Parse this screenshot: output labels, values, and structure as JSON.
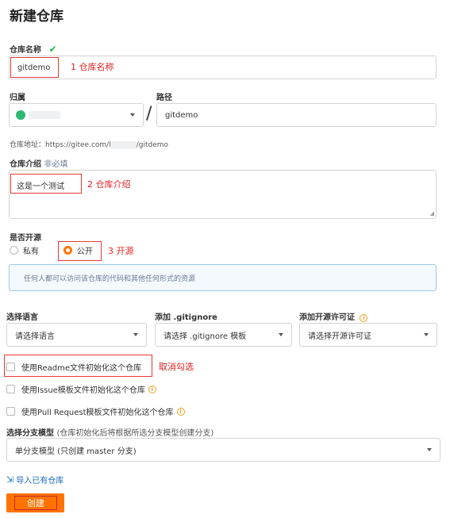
{
  "page": {
    "title": "新建仓库"
  },
  "repo_name": {
    "label": "仓库名称",
    "value": "gitdemo",
    "annotation": "1 仓库名称"
  },
  "owner": {
    "label": "归属",
    "value": ""
  },
  "path": {
    "label": "路径",
    "value": "gitdemo",
    "separator": "/"
  },
  "repo_address": {
    "text": "仓库地址：https://gitee.com/l",
    "suffix": "/gitdemo"
  },
  "description": {
    "label": "仓库介绍",
    "optional": "非必填",
    "value": "这是一个测试",
    "annotation": "2 仓库介绍"
  },
  "visibility": {
    "label": "是否开源",
    "options": [
      "私有",
      "公开"
    ],
    "selected": "公开",
    "annotation": "3 开源",
    "notice": "任何人都可以访问该仓库的代码和其他任何形式的资源"
  },
  "language": {
    "label": "选择语言",
    "placeholder": "请选择语言"
  },
  "gitignore": {
    "label": "添加 .gitignore",
    "placeholder": "请选择 .gitignore 模板"
  },
  "license": {
    "label": "添加开源许可证",
    "placeholder": "请选择开源许可证"
  },
  "init_options": {
    "readme": "使用Readme文件初始化这个仓库",
    "readme_annotation": "取消勾选",
    "issue": "使用Issue模板文件初始化这个仓库",
    "pr": "使用Pull Request模板文件初始化这个仓库"
  },
  "branch_model": {
    "label": "选择分支模型",
    "hint": "(仓库初始化后将根据所选分支模型创建分支)",
    "value": "单分支模型 (只创建 master 分支)"
  },
  "import_link": "导入已有仓库",
  "submit": "创建",
  "colors": {
    "accent": "#fe7300",
    "annotation_red": "#e02020",
    "check_green": "#21ba45",
    "notice_bg": "#f4f9fd",
    "notice_border": "#9cc8e6"
  }
}
